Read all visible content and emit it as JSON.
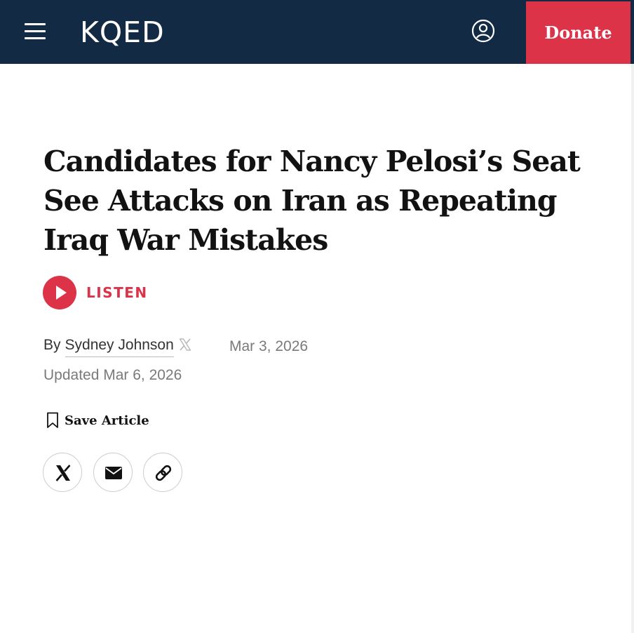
{
  "header": {
    "logo": "KQED",
    "donate_label": "Donate",
    "icons": {
      "menu": "hamburger-menu-icon",
      "account": "user-circle-icon"
    },
    "colors": {
      "background": "#132a45",
      "donate": "#dc3349"
    }
  },
  "article": {
    "title": "Candidates for Nancy Pelosi’s Seat See Attacks on Iran as Repeating Iraq War Mistakes",
    "listen_label": "LISTEN",
    "byline_prefix": "By",
    "author": "Sydney Johnson",
    "published": "Mar 3, 2026",
    "updated": "Updated Mar 6, 2026",
    "save_label": "Save Article"
  },
  "share": {
    "icons": [
      "x-logo-icon",
      "envelope-icon",
      "link-icon"
    ]
  }
}
